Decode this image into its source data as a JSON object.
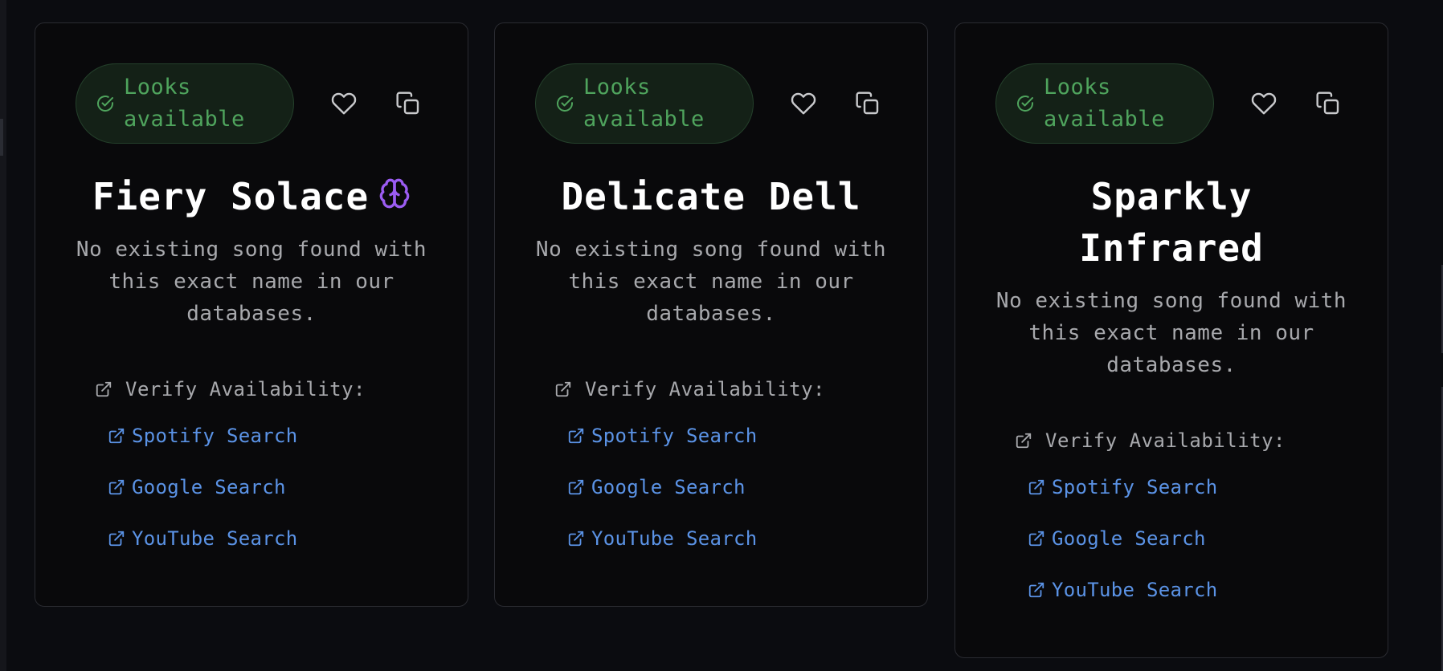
{
  "cards": [
    {
      "status": "Looks available",
      "title": "Fiery Solace",
      "title_icon": "brain-icon",
      "description": "No existing song found with this exact name in our databases.",
      "verify_label": "Verify Availability:",
      "links": [
        "Spotify Search",
        "Google Search",
        "YouTube Search"
      ]
    },
    {
      "status": "Looks available",
      "title": "Delicate Dell",
      "description": "No existing song found with this exact name in our databases.",
      "verify_label": "Verify Availability:",
      "links": [
        "Spotify Search",
        "Google Search",
        "YouTube Search"
      ]
    },
    {
      "status": "Looks available",
      "title": "Sparkly Infrared",
      "description": "No existing song found with this exact name in our databases.",
      "verify_label": "Verify Availability:",
      "links": [
        "Spotify Search",
        "Google Search",
        "YouTube Search"
      ]
    }
  ],
  "icons": {
    "status": "check-circle-icon",
    "favorite": "heart-icon",
    "copy": "copy-icon",
    "link": "external-link-icon"
  },
  "colors": {
    "background": "#0b0c10",
    "card_background": "#09090b",
    "card_border": "#2a2b31",
    "status_green": "#4fa45d",
    "status_pill_background": "#142117",
    "link_blue": "#5b93e6",
    "brain_purple": "#9b5cf2",
    "muted_text": "#a8a9ad"
  }
}
